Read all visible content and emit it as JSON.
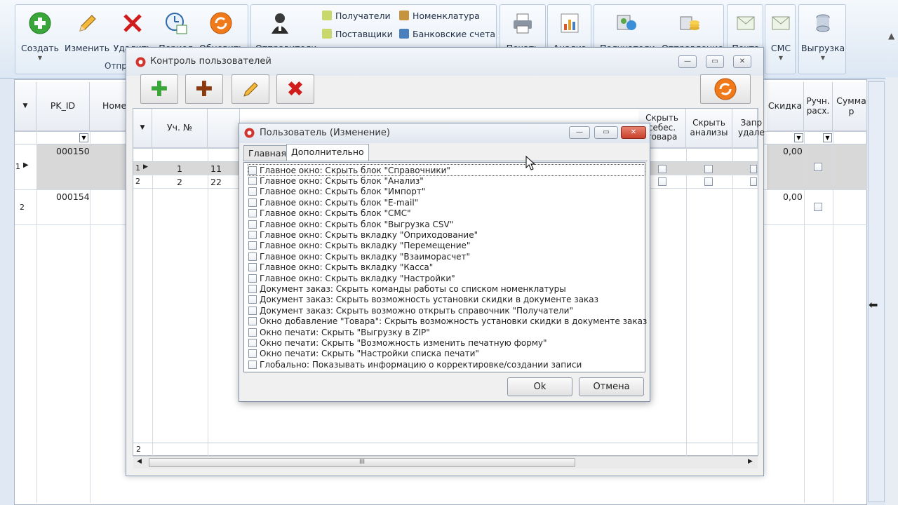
{
  "ribbon": {
    "btn_create": "Создать",
    "btn_edit": "Изменить",
    "btn_delete": "Удалить",
    "btn_period": "Период",
    "btn_refresh": "Обновить",
    "group_label_partial": "Отпр",
    "btn_senders": "Отправители",
    "item_recipients": "Получатели",
    "item_suppliers": "Поставщики",
    "item_nomenclature": "Номенклатура",
    "item_bank_accounts": "Банковские счета",
    "btn_print": "Печать",
    "btn_analysis": "Анализ",
    "btn_recipients": "Получатели",
    "btn_sending": "Отправление",
    "btn_mail": "Почта",
    "btn_sms": "СМС",
    "btn_export": "Выгрузка"
  },
  "main_grid": {
    "col_pk_id": "PK_ID",
    "col_number_partial": "Номер",
    "col_discount": "Скидка",
    "col_manual_calc": "Ручн. расх.",
    "col_sum_partial": "Сумма р",
    "rows": [
      {
        "row_num": "1",
        "pk_id": "000150",
        "discount": "0,00"
      },
      {
        "row_num": "2",
        "pk_id": "000154",
        "discount": "0,00"
      }
    ]
  },
  "users_window": {
    "title": "Контроль пользователей",
    "col_uch_no": "Уч. №",
    "col_hide_cost": "Скрыть себес. товара",
    "col_hide_analysis": "Скрыть анализы",
    "col_forbid_delete_partial": "Запр удале",
    "rows": [
      {
        "row_num": "1",
        "uch_no": "1",
        "login": "11"
      },
      {
        "row_num": "2",
        "uch_no": "2",
        "login": "22"
      }
    ],
    "footer_count": "2",
    "scroll_grip": "III"
  },
  "dialog": {
    "title": "Пользователь (Изменение)",
    "tab_main": "Главная",
    "tab_additional": "Дополнительно",
    "options": [
      {
        "label": "Главное окно: Скрыть блок \"Справочники\"",
        "checked": false
      },
      {
        "label": "Главное окно: Скрыть блок \"Анализ\"",
        "checked": false
      },
      {
        "label": "Главное окно: Скрыть блок \"Импорт\"",
        "checked": false
      },
      {
        "label": "Главное окно: Скрыть блок \"E-mail\"",
        "checked": false
      },
      {
        "label": "Главное окно: Скрыть блок \"СМС\"",
        "checked": false
      },
      {
        "label": "Главное окно: Скрыть блок \"Выгрузка CSV\"",
        "checked": false
      },
      {
        "label": "Главное окно: Скрыть вкладку \"Оприходование\"",
        "checked": false
      },
      {
        "label": "Главное окно: Скрыть вкладку \"Перемещение\"",
        "checked": false
      },
      {
        "label": "Главное окно: Скрыть вкладку \"Взаиморасчет\"",
        "checked": false
      },
      {
        "label": "Главное окно: Скрыть вкладку \"Касса\"",
        "checked": false
      },
      {
        "label": "Главное окно: Скрыть вкладку \"Настройки\"",
        "checked": false
      },
      {
        "label": "Документ заказ: Скрыть команды работы со списком номенклатуры",
        "checked": false
      },
      {
        "label": "Документ заказ: Скрыть возможность установки скидки в документе заказ",
        "checked": false
      },
      {
        "label": "Документ заказ: Скрыть возможно открыть справочник \"Получатели\"",
        "checked": false
      },
      {
        "label": "Окно добавление \"Товара\": Скрыть возможность установки скидки в документе заказ",
        "checked": false
      },
      {
        "label": "Окно печати: Скрыть \"Выгрузку в ZIP\"",
        "checked": false
      },
      {
        "label": "Окно печати: Скрыть \"Возможность изменить печатную форму\"",
        "checked": false
      },
      {
        "label": "Окно печати: Скрыть \"Настройки списка печати\"",
        "checked": false
      },
      {
        "label": "Глобально: Показывать информацию о корректировке/создании записи",
        "checked": false
      }
    ],
    "ok_label": "Ok",
    "cancel_label": "Отмена"
  },
  "colors": {
    "add_green": "#3aa63a",
    "delete_red": "#d11c1c",
    "plus_brown": "#8a3a0e",
    "refresh_orange": "#f07a1a",
    "title_red": "#d0362f"
  }
}
